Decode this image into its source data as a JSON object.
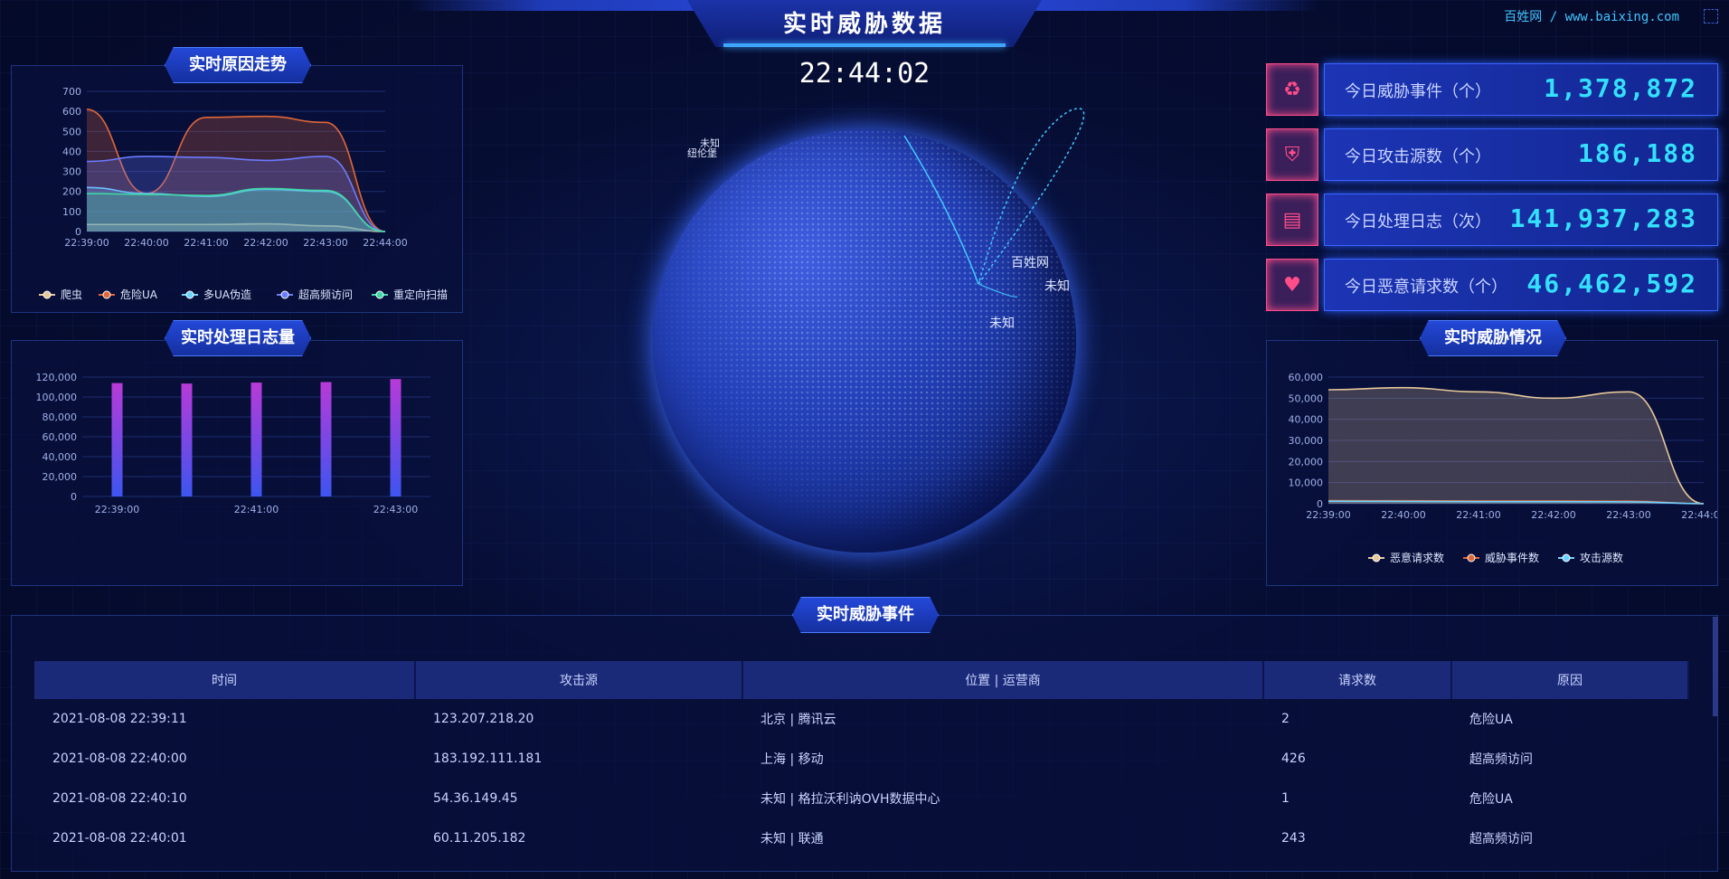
{
  "header": {
    "title": "实时威胁数据",
    "site_link": "百姓网 / www.baixing.com",
    "clock": "22:44:02"
  },
  "colors": {
    "accent": "#33e0ff",
    "brand": "#1c35b5",
    "danger": "#ff4d8a"
  },
  "panels": {
    "reason_trend": {
      "title": "实时原因走势"
    },
    "log_volume": {
      "title": "实时处理日志量"
    },
    "threat_status": {
      "title": "实时威胁情况"
    },
    "events": {
      "title": "实时威胁事件"
    }
  },
  "globe": {
    "labels": [
      "未知",
      "纽伦堡",
      "百姓网",
      "未知",
      "未知"
    ]
  },
  "stats": [
    {
      "icon": "recycle-icon",
      "label": "今日威胁事件（个）",
      "value": "1,378,872"
    },
    {
      "icon": "shield-icon",
      "label": "今日攻击源数（个）",
      "value": "186,188"
    },
    {
      "icon": "document-icon",
      "label": "今日处理日志（次）",
      "value": "141,937,283"
    },
    {
      "icon": "heartbeat-icon",
      "label": "今日恶意请求数（个）",
      "value": "46,462,592"
    }
  ],
  "chart_data": [
    {
      "type": "area",
      "title": "实时原因走势",
      "x": [
        "22:39:00",
        "22:40:00",
        "22:41:00",
        "22:42:00",
        "22:43:00",
        "22:44:00"
      ],
      "ylim": [
        0,
        700
      ],
      "yticks": [
        0,
        100,
        200,
        300,
        400,
        500,
        600,
        700
      ],
      "series": [
        {
          "name": "爬虫",
          "color": "#e6c89a",
          "values": [
            35,
            35,
            35,
            38,
            28,
            0
          ]
        },
        {
          "name": "危险UA",
          "color": "#e0673a",
          "values": [
            610,
            190,
            570,
            575,
            545,
            0
          ]
        },
        {
          "name": "多UA伪造",
          "color": "#6cd3ff",
          "values": [
            220,
            190,
            175,
            210,
            200,
            0
          ]
        },
        {
          "name": "超高频访问",
          "color": "#6b7bff",
          "values": [
            350,
            375,
            370,
            355,
            375,
            0
          ]
        },
        {
          "name": "重定向扫描",
          "color": "#3fd7a6",
          "values": [
            190,
            185,
            180,
            215,
            205,
            0
          ]
        }
      ]
    },
    {
      "type": "bar",
      "title": "实时处理日志量",
      "categories": [
        "22:39:00",
        "22:40:00",
        "22:41:00",
        "22:42:00",
        "22:43:00"
      ],
      "xticks": [
        "22:39:00",
        "22:41:00",
        "22:43:00"
      ],
      "values": [
        114000,
        113500,
        114500,
        115000,
        118000
      ],
      "ylim": [
        0,
        120000
      ],
      "yticks": [
        "0",
        "20,000",
        "40,000",
        "60,000",
        "80,000",
        "100,000",
        "120,000"
      ]
    },
    {
      "type": "area",
      "title": "实时威胁情况",
      "x": [
        "22:39:00",
        "22:40:00",
        "22:41:00",
        "22:42:00",
        "22:43:00",
        "22:44:00"
      ],
      "ylim": [
        0,
        60000
      ],
      "yticks": [
        "0",
        "10,000",
        "20,000",
        "30,000",
        "40,000",
        "50,000",
        "60,000"
      ],
      "series": [
        {
          "name": "恶意请求数",
          "color": "#e6c89a",
          "values": [
            54000,
            55000,
            53000,
            50000,
            53000,
            0
          ]
        },
        {
          "name": "威胁事件数",
          "color": "#e0673a",
          "values": [
            1500,
            1400,
            1300,
            1300,
            1200,
            0
          ]
        },
        {
          "name": "攻击源数",
          "color": "#6cd3ff",
          "values": [
            1200,
            1100,
            1000,
            1000,
            900,
            0
          ]
        }
      ]
    }
  ],
  "table": {
    "headers": [
      "时间",
      "攻击源",
      "位置 | 运营商",
      "请求数",
      "原因"
    ],
    "rows": [
      [
        "2021-08-08 22:39:11",
        "123.207.218.20",
        "北京 | 腾讯云",
        "2",
        "危险UA"
      ],
      [
        "2021-08-08 22:40:00",
        "183.192.111.181",
        "上海 | 移动",
        "426",
        "超高频访问"
      ],
      [
        "2021-08-08 22:40:10",
        "54.36.149.45",
        "未知 | 格拉沃利讷OVH数据中心",
        "1",
        "危险UA"
      ],
      [
        "2021-08-08 22:40:01",
        "60.11.205.182",
        "未知 | 联通",
        "243",
        "超高频访问"
      ]
    ]
  }
}
